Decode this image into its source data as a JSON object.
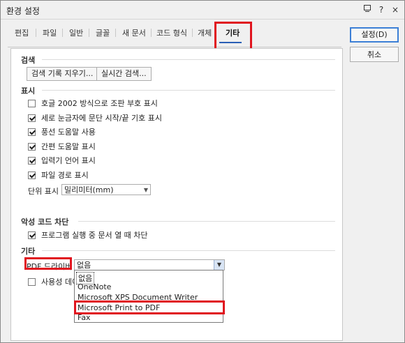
{
  "window": {
    "title": "환경 설정",
    "help": "?",
    "close": "×"
  },
  "tabs": [
    "편집",
    "파일",
    "일반",
    "글꼴",
    "새 문서",
    "코드 형식",
    "개체",
    "기타"
  ],
  "active_tab": "기타",
  "sections": {
    "search": {
      "title": "검색",
      "buttons": [
        "검색 기록 지우기...",
        "실시간 검색..."
      ]
    },
    "display": {
      "title": "표시",
      "options": [
        {
          "label": "호글 2002 방식으로 조판 부호 표시",
          "checked": false
        },
        {
          "label": "세로 눈금자에 문단 시작/끝 기호 표시",
          "checked": true
        },
        {
          "label": "풍선 도움말 사용",
          "checked": true
        },
        {
          "label": "간편 도움말 표시",
          "checked": true
        },
        {
          "label": "입력기 언어 표시",
          "checked": true
        },
        {
          "label": "파일 경로 표시",
          "checked": true
        }
      ],
      "unit_label": "단위 표시",
      "unit_value": "밀리미터(mm)"
    },
    "malware": {
      "title": "악성 코드 차단",
      "option": {
        "label": "프로그램 실행 중 문서 열 때 차단",
        "checked": true
      }
    },
    "other": {
      "title": "기타",
      "pdf_label": "PDF 드라이버",
      "pdf_value": "없음",
      "usage_label": "사용성 데이",
      "usage_checked": false,
      "pdf_options": [
        "없음",
        "OneNote",
        "Microsoft XPS Document Writer",
        "Microsoft Print to PDF",
        "Fax"
      ]
    }
  },
  "side_buttons": {
    "ok": "설정(D)",
    "cancel": "취소"
  },
  "colors": {
    "highlight": "#e0141e",
    "accent": "#2a5fb5"
  },
  "icons": {
    "restore": "restore-icon",
    "help": "help-icon",
    "close": "close-icon"
  }
}
